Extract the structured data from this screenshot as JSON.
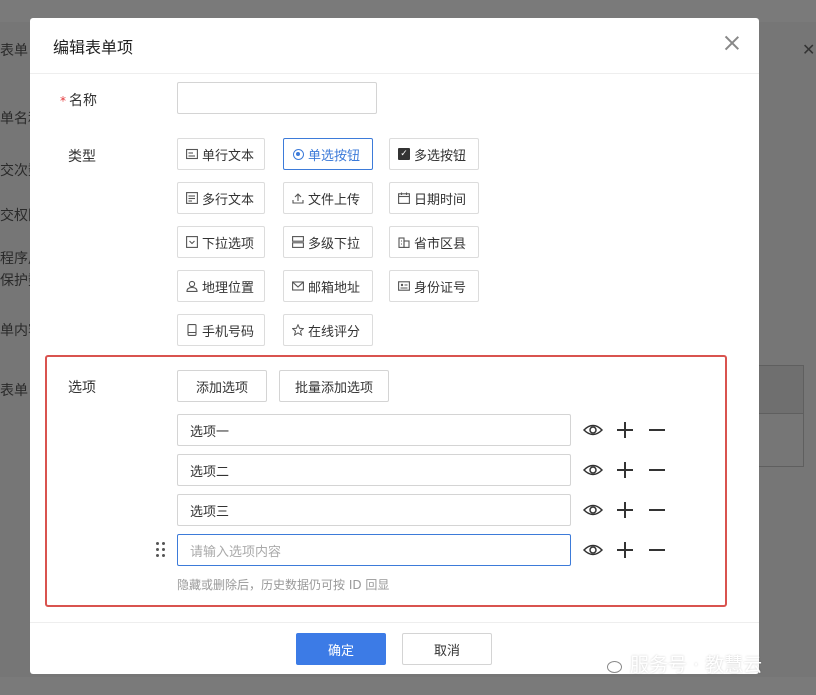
{
  "modal": {
    "title": "编辑表单项",
    "name_label": "名称",
    "required_mark": "*",
    "name_value": "",
    "type_label": "类型",
    "types": [
      {
        "label": "单行文本",
        "icon": "single-line-text-icon",
        "selected": false
      },
      {
        "label": "单选按钮",
        "icon": "radio-icon",
        "selected": true
      },
      {
        "label": "多选按钮",
        "icon": "checkbox-icon",
        "selected": false
      },
      {
        "label": "多行文本",
        "icon": "multi-line-text-icon",
        "selected": false
      },
      {
        "label": "文件上传",
        "icon": "upload-icon",
        "selected": false
      },
      {
        "label": "日期时间",
        "icon": "calendar-icon",
        "selected": false
      },
      {
        "label": "下拉选项",
        "icon": "dropdown-icon",
        "selected": false
      },
      {
        "label": "多级下拉",
        "icon": "multi-level-dropdown-icon",
        "selected": false
      },
      {
        "label": "省市区县",
        "icon": "building-icon",
        "selected": false
      },
      {
        "label": "地理位置",
        "icon": "location-icon",
        "selected": false
      },
      {
        "label": "邮箱地址",
        "icon": "mail-icon",
        "selected": false
      },
      {
        "label": "身份证号",
        "icon": "id-card-icon",
        "selected": false
      },
      {
        "label": "手机号码",
        "icon": "phone-icon",
        "selected": false
      },
      {
        "label": "在线评分",
        "icon": "star-icon",
        "selected": false
      }
    ],
    "options_label": "选项",
    "add_option_label": "添加选项",
    "batch_add_label": "批量添加选项",
    "options": [
      "选项一",
      "选项二",
      "选项三"
    ],
    "new_option_placeholder": "请输入选项内容",
    "hint": "隐藏或删除后，历史数据仍可按 ID 回显",
    "confirm_label": "确定",
    "cancel_label": "取消"
  },
  "background": {
    "labels": [
      "表单",
      "单名和",
      "交次数",
      "交权限",
      "程序用",
      "保护数",
      "单内容",
      "表单"
    ]
  },
  "watermark": {
    "text": "服务号 · 教慧云"
  },
  "colors": {
    "primary": "#3c7be6",
    "highlight_border": "#d9534f",
    "required": "#e4393c"
  }
}
